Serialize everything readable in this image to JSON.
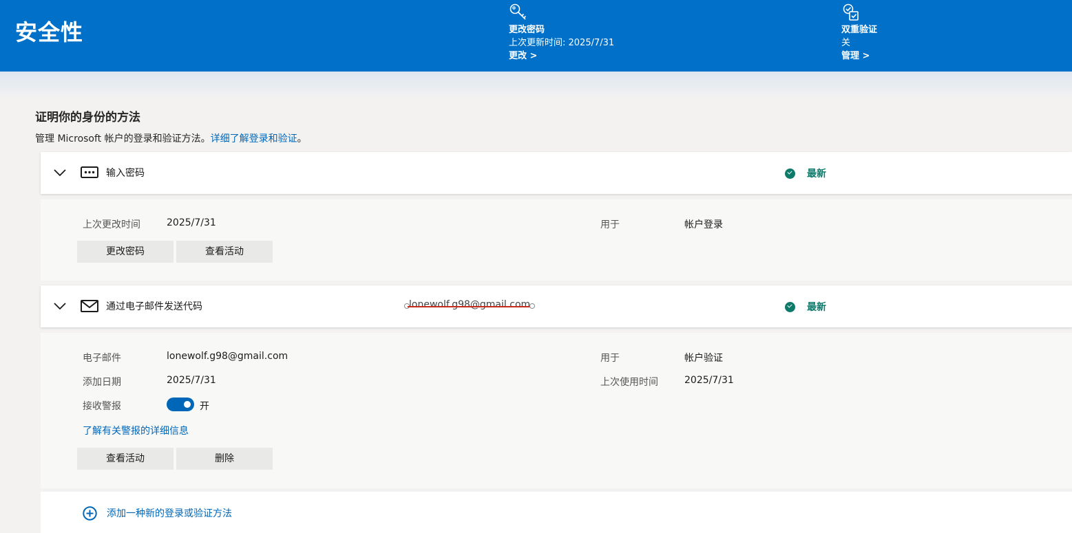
{
  "banner": {
    "title": "安全性",
    "password": {
      "title": "更改密码",
      "subtitle": "上次更新时间: 2025/7/31",
      "link": "更改 >"
    },
    "twofa": {
      "title": "双重验证",
      "subtitle": "关",
      "link": "管理 >"
    }
  },
  "section": {
    "title": "证明你的身份的方法",
    "desc": "管理 Microsoft 帐户的登录和验证方法。",
    "desc_link": "详细了解登录和验证",
    "desc_end": "。"
  },
  "methods": [
    {
      "name": "输入密码",
      "status": "最新",
      "details": {
        "last_changed_label": "上次更改时间",
        "last_changed_value": "2025/7/31",
        "used_for_label": "用于",
        "used_for_value": "帐户登录"
      },
      "buttons": [
        "更改密码",
        "查看活动"
      ]
    },
    {
      "name": "通过电子邮件发送代码",
      "header_email": "lonewolf.g98@gmail.com",
      "status": "最新",
      "details": {
        "email_label": "电子邮件",
        "email_value": "lonewolf.g98@gmail.com",
        "used_for_label": "用于",
        "used_for_value": "帐户验证",
        "added_label": "添加日期",
        "added_value": "2025/7/31",
        "last_used_label": "上次使用时间",
        "last_used_value": "2025/7/31",
        "alerts_label": "接收警报",
        "alerts_state": "开",
        "alerts_on": true,
        "alerts_link": "了解有关警报的详细信息"
      },
      "buttons": [
        "查看活动",
        "删除"
      ]
    }
  ],
  "add_method": "添加一种新的登录或验证方法",
  "colors": {
    "banner": "#0070c9",
    "accent": "#0067b8",
    "status": "#0e7a6a"
  }
}
